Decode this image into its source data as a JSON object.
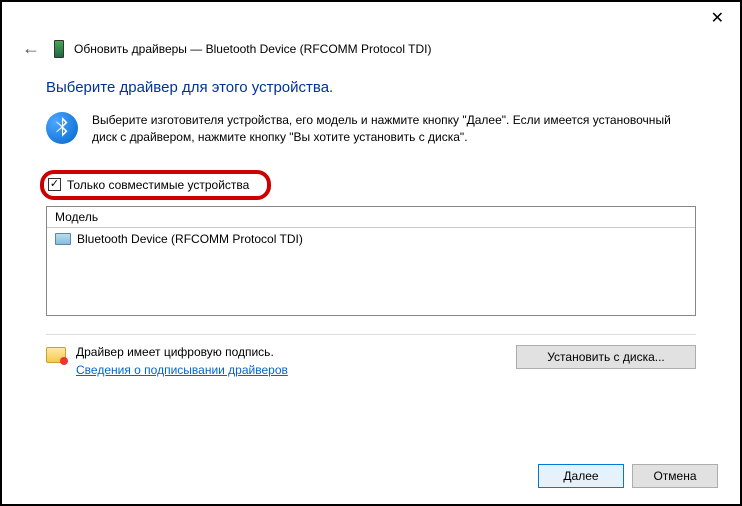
{
  "titlebar": {
    "close": "✕"
  },
  "header": {
    "back": "←",
    "title": "Обновить драйверы — Bluetooth Device (RFCOMM Protocol TDI)"
  },
  "heading": "Выберите драйвер для этого устройства.",
  "info_text": "Выберите изготовителя устройства, его модель и нажмите кнопку \"Далее\". Если имеется установочный диск с драйвером, нажмите кнопку \"Вы хотите установить с диска\".",
  "checkbox": {
    "checked": "✓",
    "label": "Только совместимые устройства"
  },
  "list": {
    "header": "Модель",
    "items": [
      "Bluetooth Device (RFCOMM Protocol TDI)"
    ]
  },
  "signature": {
    "text": "Драйвер имеет цифровую подпись.",
    "link": "Сведения о подписывании драйверов"
  },
  "buttons": {
    "install": "Установить с диска...",
    "next": "Далее",
    "cancel": "Отмена"
  }
}
